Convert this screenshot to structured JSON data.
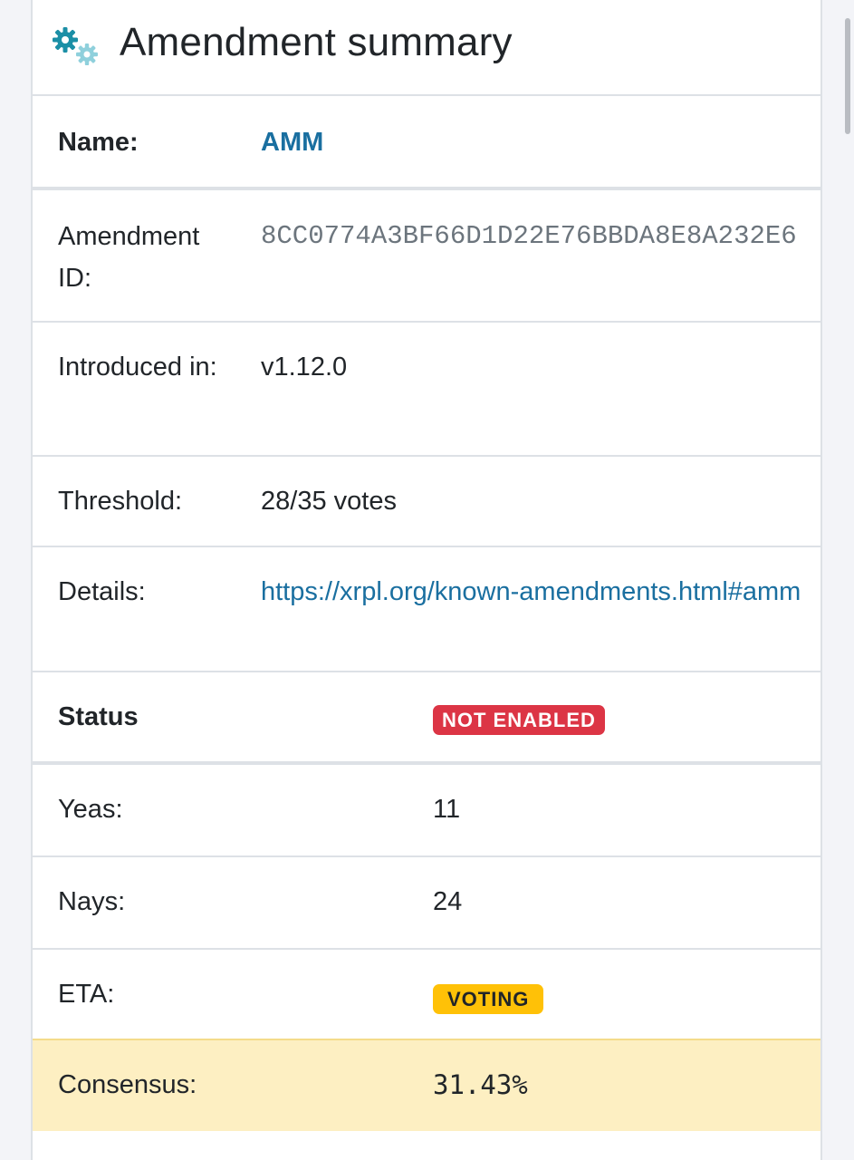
{
  "header": {
    "title": "Amendment summary",
    "icon": "gears-icon"
  },
  "summary": {
    "name_label": "Name:",
    "name_value": "AMM",
    "id_label": "Amendment ID:",
    "id_value": "8CC0774A3BF66D1D22E76BBDA8E8A232E6",
    "introduced_label": "Introduced in:",
    "introduced_value": "v1.12.0",
    "threshold_label": "Threshold:",
    "threshold_value": "28/35 votes",
    "details_label": "Details:",
    "details_value": "https://xrpl.org/known-amendments.html#amm"
  },
  "status": {
    "status_label": "Status",
    "status_badge": "NOT ENABLED",
    "yeas_label": "Yeas:",
    "yeas_value": "11",
    "nays_label": "Nays:",
    "nays_value": "24",
    "eta_label": "ETA:",
    "eta_badge": "VOTING",
    "consensus_label": "Consensus:",
    "consensus_value": "31.43%"
  },
  "colors": {
    "link": "#1a6fa0",
    "badge_not_enabled": "#dc3545",
    "badge_voting": "#ffc107",
    "consensus_highlight": "#fdefc2",
    "icon_primary": "#1b8fa6",
    "icon_secondary": "#8fd0dc"
  }
}
